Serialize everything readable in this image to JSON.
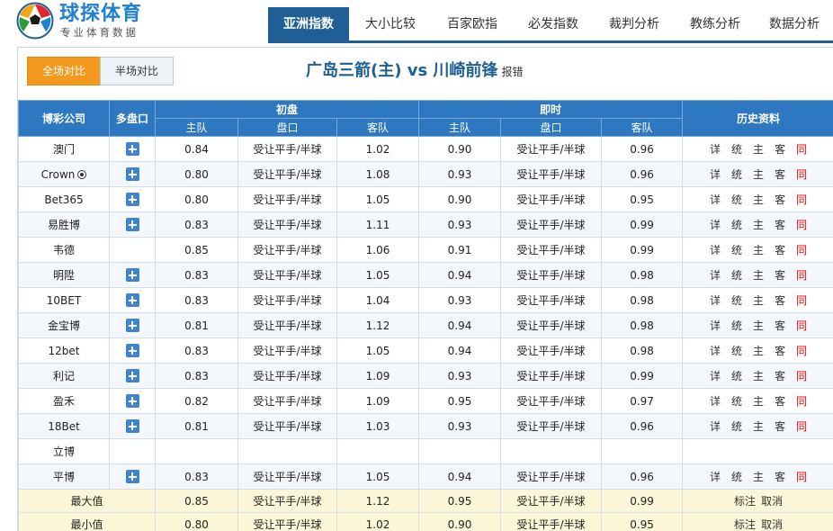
{
  "logo": {
    "title": "球探体育",
    "subtitle": "专业体育数据"
  },
  "nav": [
    {
      "label": "亚洲指数",
      "active": true
    },
    {
      "label": "大小比较",
      "active": false
    },
    {
      "label": "百家欧指",
      "active": false
    },
    {
      "label": "必发指数",
      "active": false
    },
    {
      "label": "裁判分析",
      "active": false
    },
    {
      "label": "教练分析",
      "active": false
    },
    {
      "label": "数据分析",
      "active": false
    }
  ],
  "toggle": {
    "full": "全场对比",
    "half": "半场对比"
  },
  "match": {
    "title": "广岛三箭(主) vs 川崎前锋",
    "report": "报错"
  },
  "headers": {
    "company": "博彩公司",
    "multi": "多盘口",
    "initial": "初盘",
    "live": "即时",
    "history": "历史资料",
    "home": "主队",
    "line": "盘口",
    "away": "客队"
  },
  "history_links": [
    "详",
    "统",
    "主",
    "客",
    "同"
  ],
  "rows": [
    {
      "company": "澳门",
      "plus": true,
      "i_home": "0.84",
      "i_line": "受让平手/半球",
      "i_away": "1.02",
      "l_home": "0.90",
      "l_line": "受让平手/半球",
      "l_away": "0.96",
      "links": true
    },
    {
      "company": "Crown",
      "crown_icon": true,
      "plus": true,
      "i_home": "0.80",
      "i_line": "受让平手/半球",
      "i_away": "1.08",
      "l_home": "0.93",
      "l_line": "受让平手/半球",
      "l_away": "0.96",
      "links": true
    },
    {
      "company": "Bet365",
      "plus": true,
      "i_home": "0.80",
      "i_line": "受让平手/半球",
      "i_away": "1.05",
      "l_home": "0.90",
      "l_line": "受让平手/半球",
      "l_away": "0.95",
      "links": true
    },
    {
      "company": "易胜博",
      "plus": true,
      "i_home": "0.83",
      "i_line": "受让平手/半球",
      "i_away": "1.11",
      "l_home": "0.93",
      "l_line": "受让平手/半球",
      "l_away": "0.99",
      "links": true
    },
    {
      "company": "韦德",
      "plus": false,
      "i_home": "0.85",
      "i_line": "受让平手/半球",
      "i_away": "1.06",
      "l_home": "0.91",
      "l_line": "受让平手/半球",
      "l_away": "0.99",
      "links": true
    },
    {
      "company": "明陞",
      "plus": true,
      "i_home": "0.83",
      "i_line": "受让平手/半球",
      "i_away": "1.05",
      "l_home": "0.94",
      "l_line": "受让平手/半球",
      "l_away": "0.98",
      "links": true
    },
    {
      "company": "10BET",
      "plus": true,
      "i_home": "0.83",
      "i_line": "受让平手/半球",
      "i_away": "1.04",
      "l_home": "0.93",
      "l_line": "受让平手/半球",
      "l_away": "0.98",
      "links": true
    },
    {
      "company": "金宝博",
      "plus": true,
      "i_home": "0.81",
      "i_line": "受让平手/半球",
      "i_away": "1.12",
      "l_home": "0.94",
      "l_line": "受让平手/半球",
      "l_away": "0.98",
      "links": true
    },
    {
      "company": "12bet",
      "plus": true,
      "i_home": "0.83",
      "i_line": "受让平手/半球",
      "i_away": "1.05",
      "l_home": "0.94",
      "l_line": "受让平手/半球",
      "l_away": "0.98",
      "links": true
    },
    {
      "company": "利记",
      "plus": true,
      "i_home": "0.83",
      "i_line": "受让平手/半球",
      "i_away": "1.09",
      "l_home": "0.93",
      "l_line": "受让平手/半球",
      "l_away": "0.99",
      "links": true
    },
    {
      "company": "盈禾",
      "plus": true,
      "i_home": "0.82",
      "i_line": "受让平手/半球",
      "i_away": "1.09",
      "l_home": "0.95",
      "l_line": "受让平手/半球",
      "l_away": "0.97",
      "links": true
    },
    {
      "company": "18Bet",
      "plus": true,
      "i_home": "0.81",
      "i_line": "受让平手/半球",
      "i_away": "1.03",
      "l_home": "0.93",
      "l_line": "受让平手/半球",
      "l_away": "0.96",
      "links": true
    },
    {
      "company": "立博",
      "plus": false,
      "i_home": "",
      "i_line": "",
      "i_away": "",
      "l_home": "",
      "l_line": "",
      "l_away": "",
      "links": false
    },
    {
      "company": "平博",
      "plus": true,
      "i_home": "0.83",
      "i_line": "受让平手/半球",
      "i_away": "1.05",
      "l_home": "0.94",
      "l_line": "受让平手/半球",
      "l_away": "0.96",
      "links": true
    }
  ],
  "summary": [
    {
      "label": "最大值",
      "i_home": "0.85",
      "i_line": "受让平手/半球",
      "i_away": "1.12",
      "l_home": "0.95",
      "l_line": "受让平手/半球",
      "l_away": "0.99"
    },
    {
      "label": "最小值",
      "i_home": "0.80",
      "i_line": "受让平手/半球",
      "i_away": "1.02",
      "l_home": "0.90",
      "l_line": "受让平手/半球",
      "l_away": "0.95"
    }
  ],
  "summary_links": [
    "标注",
    "取消"
  ],
  "colors": {
    "accent": "#1f5f96",
    "header_bg": "#2e78c2",
    "toggle_on": "#f39a1e",
    "link_red": "#dd0000",
    "summary_bg": "#fbf7d8"
  }
}
